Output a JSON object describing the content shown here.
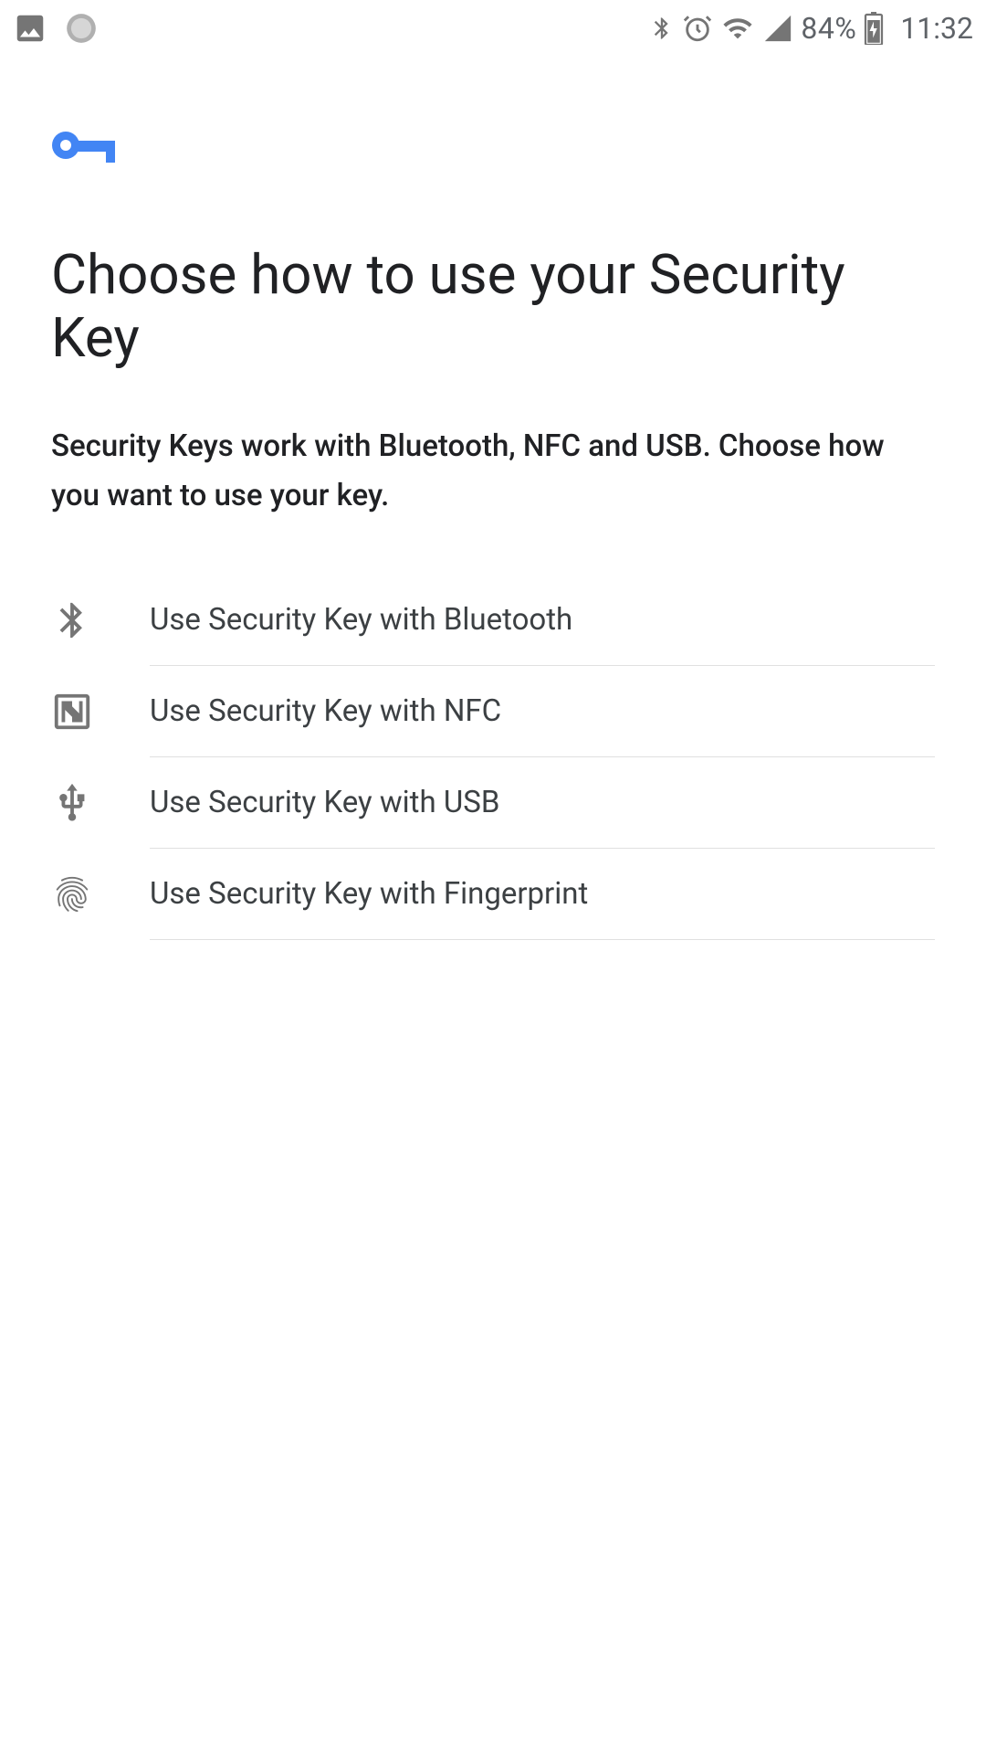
{
  "status_bar": {
    "battery_percent": "84%",
    "time": "11:32"
  },
  "main": {
    "title": "Choose how to use your Security Key",
    "subtitle": "Security Keys work with Bluetooth, NFC and USB. Choose how you want to use your key.",
    "options": [
      {
        "label": "Use Security Key with Bluetooth"
      },
      {
        "label": "Use Security Key with NFC"
      },
      {
        "label": "Use Security Key with USB"
      },
      {
        "label": "Use Security Key with Fingerprint"
      }
    ]
  },
  "colors": {
    "accent": "#4285f4",
    "icon_gray": "#757575"
  }
}
